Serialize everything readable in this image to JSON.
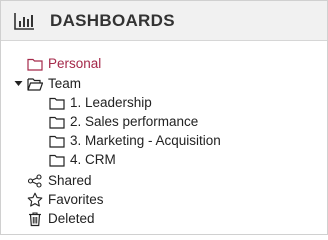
{
  "header": {
    "title": "DASHBOARDS",
    "icon": "bar-chart-icon"
  },
  "tree": {
    "personal": {
      "label": "Personal",
      "icon": "folder-icon",
      "color": "#a5294a"
    },
    "team": {
      "label": "Team",
      "icon": "folder-open-icon",
      "expanded": true,
      "children": [
        {
          "label": "1. Leadership",
          "icon": "folder-icon"
        },
        {
          "label": "2. Sales performance",
          "icon": "folder-icon"
        },
        {
          "label": "3. Marketing - Acquisition",
          "icon": "folder-icon"
        },
        {
          "label": "4. CRM",
          "icon": "folder-icon"
        }
      ]
    },
    "shared": {
      "label": "Shared",
      "icon": "share-icon"
    },
    "favorites": {
      "label": "Favorites",
      "icon": "star-icon"
    },
    "deleted": {
      "label": "Deleted",
      "icon": "trash-icon"
    }
  }
}
